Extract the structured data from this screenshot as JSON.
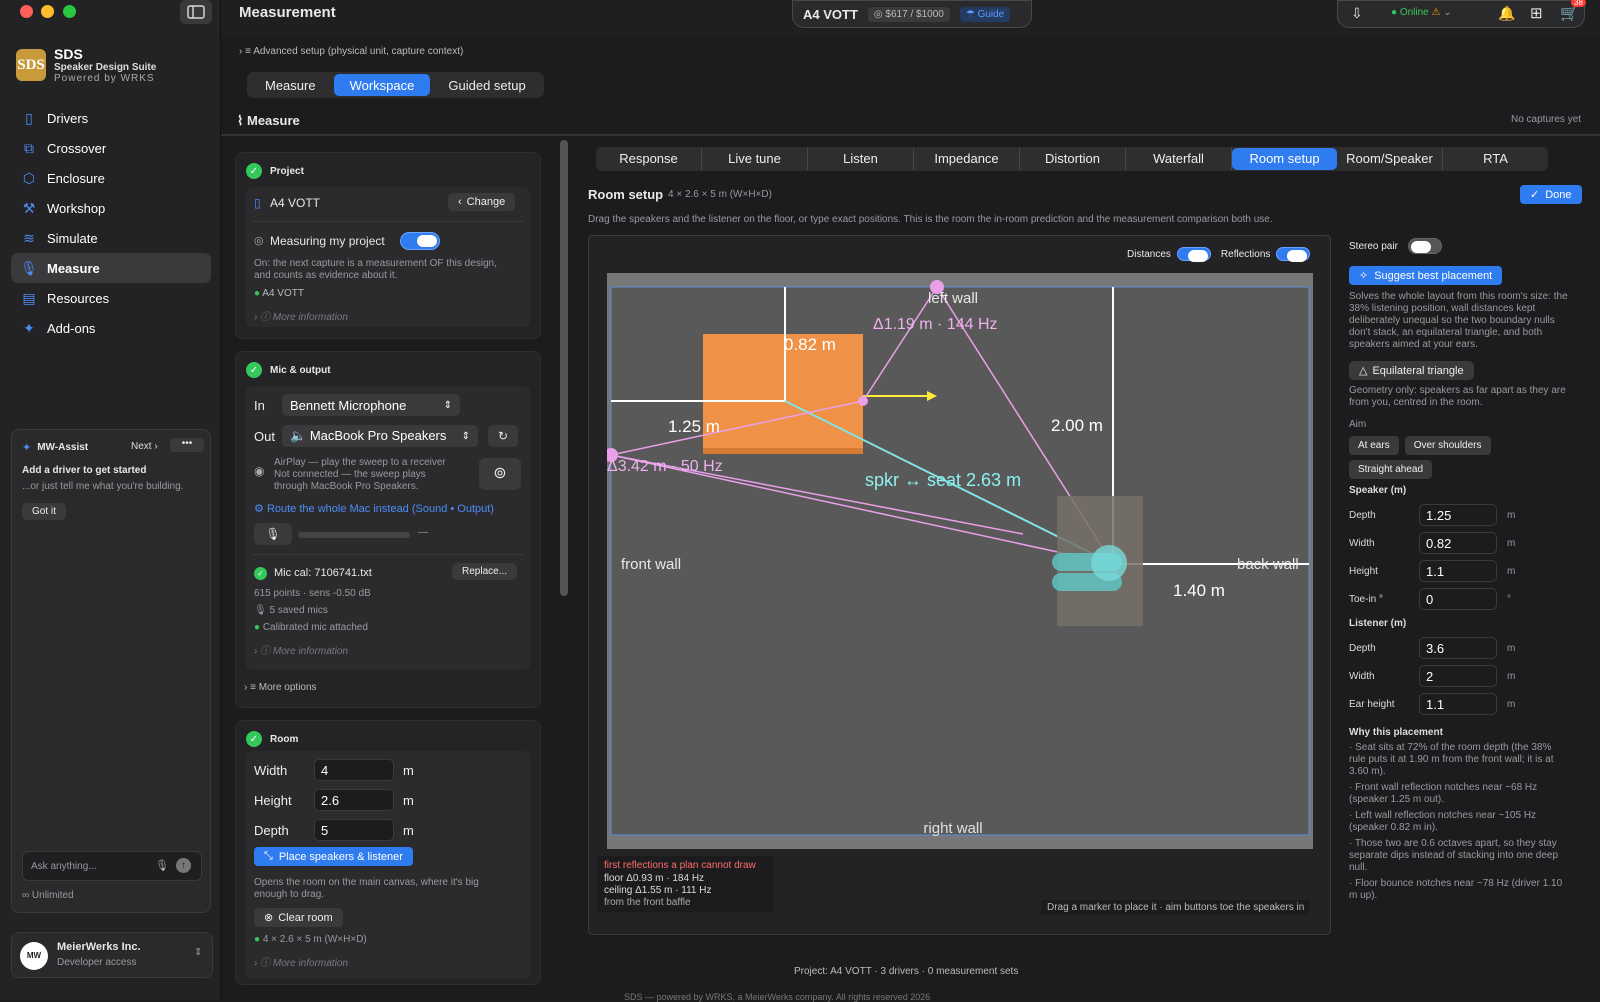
{
  "brand": {
    "name": "SDS",
    "subtitle": "Speaker Design Suite",
    "powered": "Powered by WRKS",
    "logo": "SDS"
  },
  "nav": [
    {
      "label": "Drivers",
      "icon": "speaker-icon"
    },
    {
      "label": "Crossover",
      "icon": "crossover-icon"
    },
    {
      "label": "Enclosure",
      "icon": "box-icon"
    },
    {
      "label": "Workshop",
      "icon": "hammer-icon"
    },
    {
      "label": "Simulate",
      "icon": "waves-icon"
    },
    {
      "label": "Measure",
      "icon": "mic-icon",
      "active": true
    },
    {
      "label": "Resources",
      "icon": "book-icon"
    },
    {
      "label": "Add-ons",
      "icon": "sparkle-icon"
    }
  ],
  "assist": {
    "title": "MW-Assist",
    "next": "Next",
    "headline": "Add a driver to get started",
    "sub": "...or just tell me what you're building.",
    "got_it": "Got it",
    "ask_placeholder": "Ask anything...",
    "plan": "Unlimited"
  },
  "account": {
    "name": "MeierWerks Inc.",
    "role": "Developer access",
    "avatar": "MW"
  },
  "topbar": {
    "title": "Measurement",
    "project": "A4 VOTT",
    "budget": "$617 / $1000",
    "guide": "Guide",
    "status": "Online",
    "cart_badge": "38"
  },
  "advanced": "Advanced setup (physical unit, capture context)",
  "mode_tabs": [
    "Measure",
    "Workspace",
    "Guided setup"
  ],
  "mode_active": 1,
  "section": {
    "title": "Measure",
    "captures": "No captures yet"
  },
  "project": {
    "title": "Project",
    "name": "A4 VOTT",
    "change": "Change",
    "measuring": "Measuring my project",
    "desc1": "On: the next capture is a measurement OF this design,",
    "desc2": "and counts as evidence about it.",
    "tag": "A4 VOTT",
    "more": "More information"
  },
  "mic": {
    "title": "Mic & output",
    "in_label": "In",
    "in_value": "Bennett Microphone",
    "out_label": "Out",
    "out_value": "MacBook Pro Speakers",
    "airplay1": "AirPlay — play the sweep to a receiver",
    "airplay2": "Not connected — the sweep plays",
    "airplay3": "through MacBook Pro Speakers.",
    "route": "Route the whole Mac instead (Sound • Output)",
    "level": "—",
    "cal": "Mic cal: 7106741.txt",
    "replace": "Replace...",
    "points": "615 points · sens -0.50 dB",
    "saved": "5 saved mics",
    "calibrated": "Calibrated mic attached",
    "more": "More information",
    "more_options": "More options"
  },
  "room": {
    "title": "Room",
    "width_label": "Width",
    "width": "4",
    "height_label": "Height",
    "height": "2.6",
    "depth_label": "Depth",
    "depth": "5",
    "unit": "m",
    "place": "Place speakers & listener",
    "place_desc1": "Opens the room on the main canvas, where it's big",
    "place_desc2": "enough to drag.",
    "clear": "Clear room",
    "dims": "4 × 2.6 × 5 m (W×H×D)",
    "more": "More information"
  },
  "tabs": [
    "Response",
    "Live tune",
    "Listen",
    "Impedance",
    "Distortion",
    "Waterfall",
    "Room setup",
    "Room/Speaker",
    "RTA"
  ],
  "tab_active": 6,
  "room_setup": {
    "title": "Room setup",
    "dims": "4 × 2.6 × 5 m (W×H×D)",
    "done": "Done",
    "desc": "Drag the speakers and the listener on the floor, or type exact positions. This is the room the in-room prediction and the measurement comparison both use.",
    "distances": "Distances",
    "reflections": "Reflections"
  },
  "plan": {
    "left_wall": "left wall",
    "right_wall": "right wall",
    "front_wall": "front wall",
    "back_wall": "back wall",
    "d_082": "0.82 m",
    "d_125": "1.25 m",
    "d_200": "2.00 m",
    "d_140": "1.40 m",
    "refl_side": "Δ1.19 m · 144 Hz",
    "refl_front": "Δ3.42 m · 50 Hz",
    "spkr_seat": "spkr ↔ seat  2.63 m",
    "note_title": "first reflections a plan cannot draw",
    "note_floor": "floor  Δ0.93 m · 184 Hz",
    "note_ceiling": "ceiling  Δ1.55 m · 111 Hz",
    "note_from": "from the front baffle",
    "hint": "Drag a marker to place it · aim buttons toe the speakers in"
  },
  "right": {
    "stereo": "Stereo pair",
    "suggest": "Suggest best placement",
    "suggest_desc": [
      "Solves the whole layout from this room's size: the",
      "38% listening position, wall distances kept",
      "deliberately unequal so the two boundary nulls",
      "don't stack, an equilateral triangle, and both",
      "speakers aimed at your ears."
    ],
    "equi": "Equilateral triangle",
    "equi_desc": [
      "Geometry only: speakers as far apart as they are",
      "from you, centred in the room."
    ],
    "aim": "Aim",
    "aim_opts": [
      "At ears",
      "Over shoulders",
      "Straight ahead"
    ],
    "speaker_title": "Speaker (m)",
    "sp_depth_l": "Depth",
    "sp_depth": "1.25",
    "sp_width_l": "Width",
    "sp_width": "0.82",
    "sp_height_l": "Height",
    "sp_height": "1.1",
    "toe_l": "Toe-in °",
    "toe": "0",
    "unit": "m",
    "deg": "°",
    "listener_title": "Listener (m)",
    "li_depth_l": "Depth",
    "li_depth": "3.6",
    "li_width_l": "Width",
    "li_width": "2",
    "ear_l": "Ear height",
    "ear": "1.1",
    "why": "Why this placement",
    "reasons": [
      [
        "· Seat sits at 72% of the room depth (the 38%",
        "rule puts it at 1.90 m from the front wall; it is at",
        "3.60 m)."
      ],
      [
        "· Front wall reflection notches near ~68 Hz",
        "(speaker 1.25 m out)."
      ],
      [
        "· Left wall reflection notches near ~105 Hz",
        "(speaker 0.82 m in)."
      ],
      [
        "· Those two are 0.6 octaves apart, so they stay",
        "separate dips instead of stacking into one deep",
        "null."
      ],
      [
        "· Floor bounce notches near ~78 Hz (driver 1.10",
        "m up)."
      ]
    ]
  },
  "footer": {
    "project": "Project: A4 VOTT · 3 drivers · 0 measurement sets",
    "copyright": "SDS — powered by WRKS, a MeierWerks company. All rights reserved 2026"
  }
}
